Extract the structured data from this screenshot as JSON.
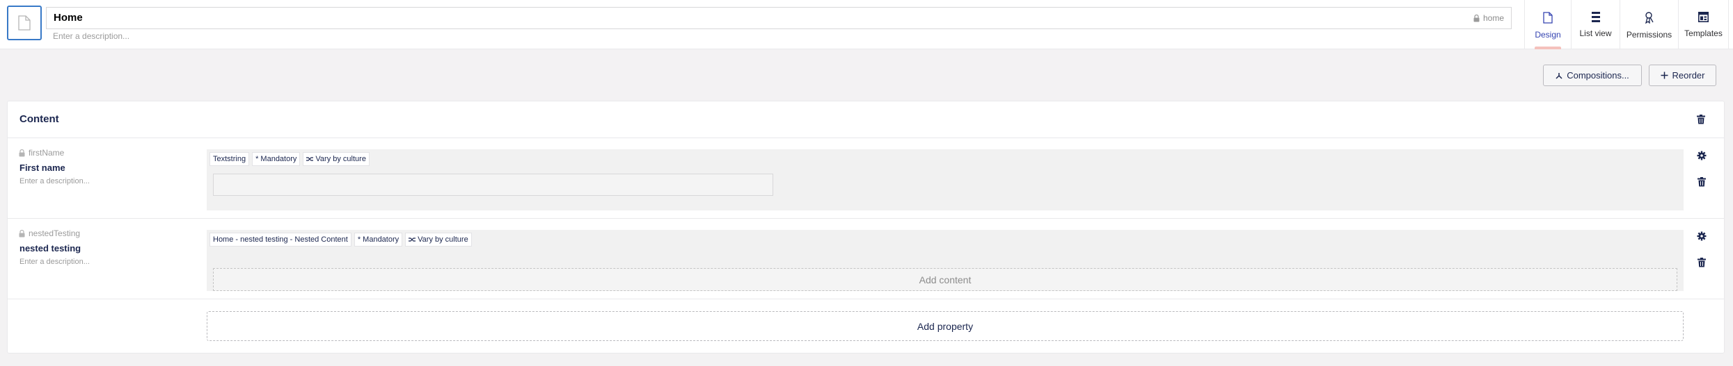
{
  "header": {
    "name_value": "Home",
    "alias": "home",
    "description_placeholder": "Enter a description...",
    "tabs": [
      {
        "label": "Design",
        "icon": "document-icon",
        "active": true
      },
      {
        "label": "List view",
        "icon": "list-icon",
        "active": false
      },
      {
        "label": "Permissions",
        "icon": "permissions-icon",
        "active": false
      },
      {
        "label": "Templates",
        "icon": "templates-icon",
        "active": false
      }
    ]
  },
  "toolbar": {
    "compositions_label": "Compositions...",
    "reorder_label": "Reorder"
  },
  "group": {
    "title": "Content",
    "properties": [
      {
        "alias": "firstName",
        "name": "First name",
        "description_placeholder": "Enter a description...",
        "tags": [
          "Textstring",
          "* Mandatory",
          "Vary by culture"
        ]
      },
      {
        "alias": "nestedTesting",
        "name": "nested testing",
        "description_placeholder": "Enter a description...",
        "tags": [
          "Home - nested testing - Nested Content",
          "* Mandatory",
          "Vary by culture"
        ],
        "add_content_label": "Add content"
      }
    ],
    "add_property_label": "Add property"
  },
  "colors": {
    "accent": "#3879c7",
    "text": "#1b264f",
    "active_tab": "#3544b1",
    "active_indicator": "#f5c1bc",
    "background": "#f3f2f3"
  }
}
